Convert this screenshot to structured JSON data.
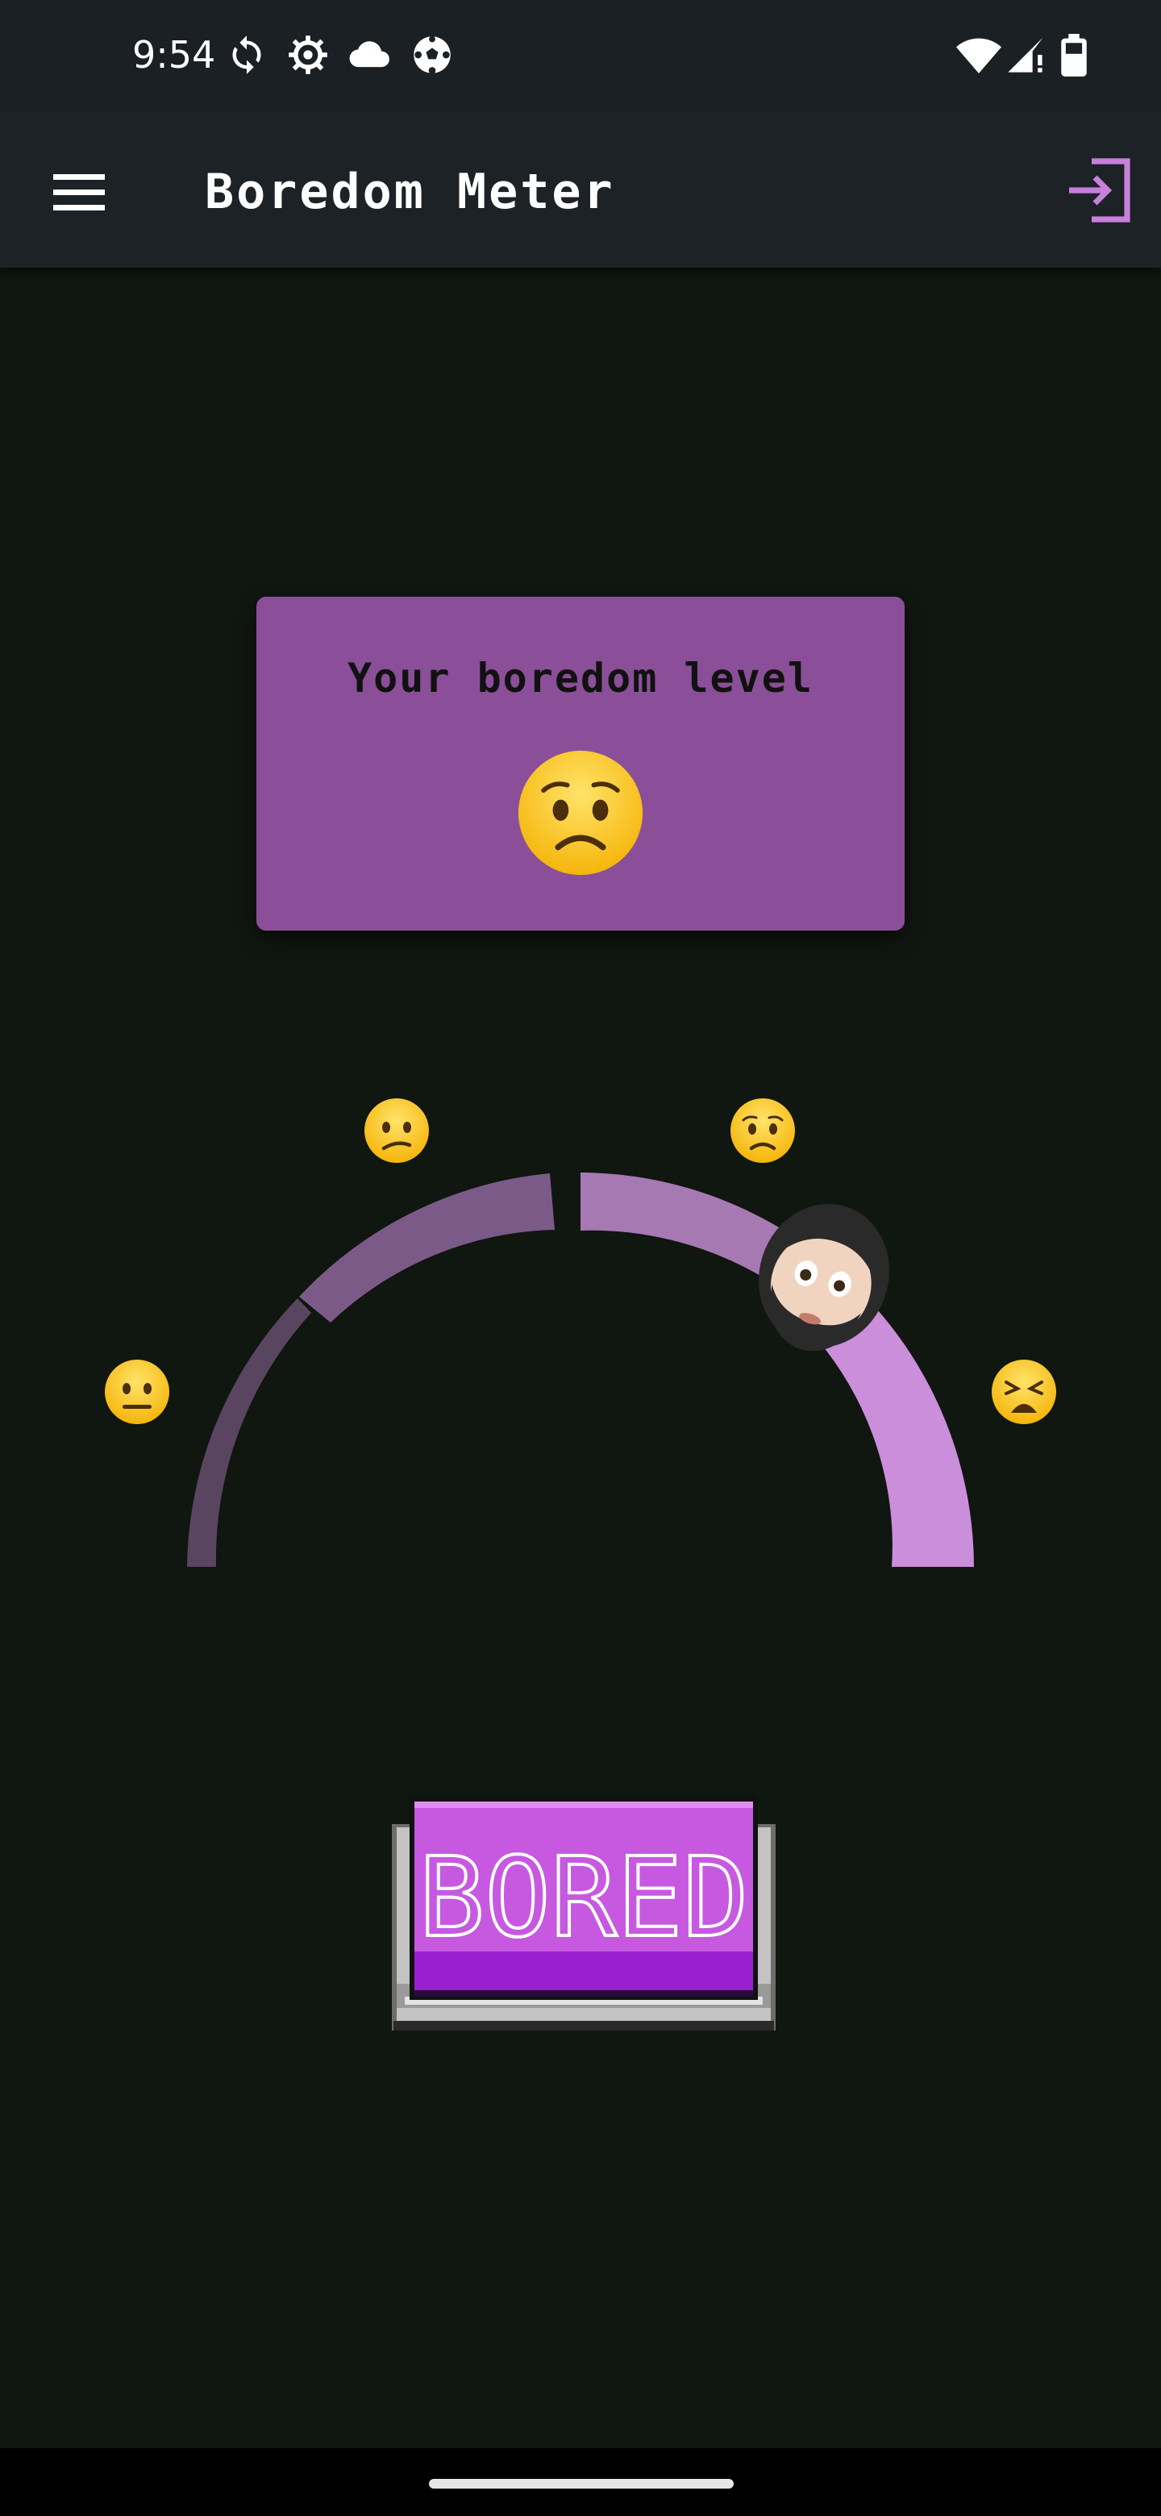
{
  "status_bar": {
    "time": "9:54",
    "left_icons": [
      "sync-icon",
      "settings-gear-icon",
      "cloud-icon",
      "soccer-ball-icon"
    ],
    "right_icons": [
      "wifi-icon",
      "cellular-signal-icon",
      "battery-icon"
    ]
  },
  "app_bar": {
    "title": "Boredom Meter",
    "menu_icon": "hamburger-menu-icon",
    "exit_icon": "logout-icon"
  },
  "level_card": {
    "title": "Your boredom level",
    "emoji": "worried-face",
    "background": "#8a4f98"
  },
  "gauge": {
    "labels": [
      "neutral-face",
      "confused-face",
      "worried-face",
      "tired-face"
    ],
    "segment_colors": [
      "#5a4560",
      "#7b5a88",
      "#a679b3",
      "#cb8edb"
    ],
    "level_percent": 72,
    "pointer": "bearded-man-emoji"
  },
  "bored_button": {
    "label": "BORED",
    "color": "#c659e0"
  },
  "colors": {
    "background": "#101610",
    "app_bar": "#1d2226",
    "accent": "#c880dc"
  }
}
